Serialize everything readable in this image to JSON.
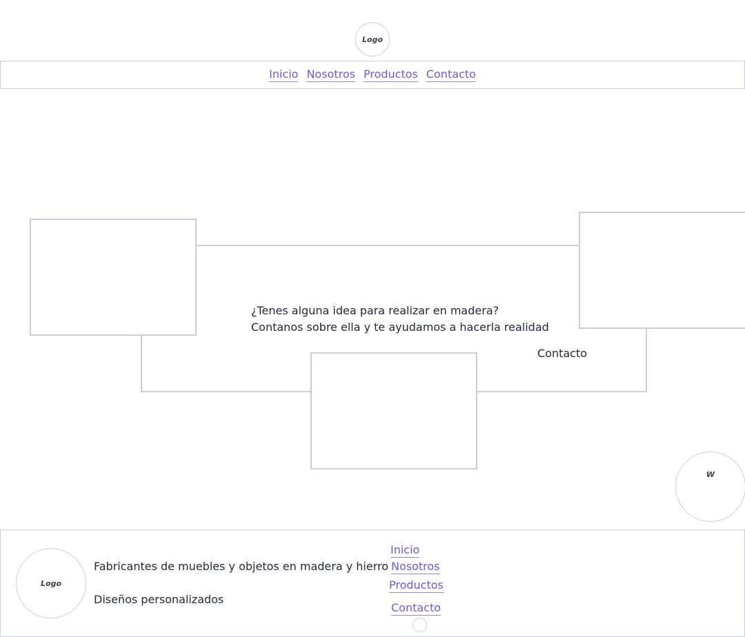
{
  "header": {
    "logo_text": "Logo",
    "nav": [
      "Inicio",
      "Nosotros",
      "Productos",
      "Contacto"
    ]
  },
  "hero": {
    "line1": "¿Tenes alguna idea para realizar en madera?",
    "line2": "Contanos sobre ella y te ayudamos a hacerla realidad",
    "contact_label": "Contacto"
  },
  "whatsapp": {
    "label": "W"
  },
  "footer": {
    "logo_text": "Logo",
    "tagline": "Fabricantes de muebles y objetos en madera y hierro",
    "subtitle": "Diseños personalizados",
    "nav": [
      "Inicio",
      "Nosotros",
      "Productos",
      "Contacto"
    ]
  }
}
